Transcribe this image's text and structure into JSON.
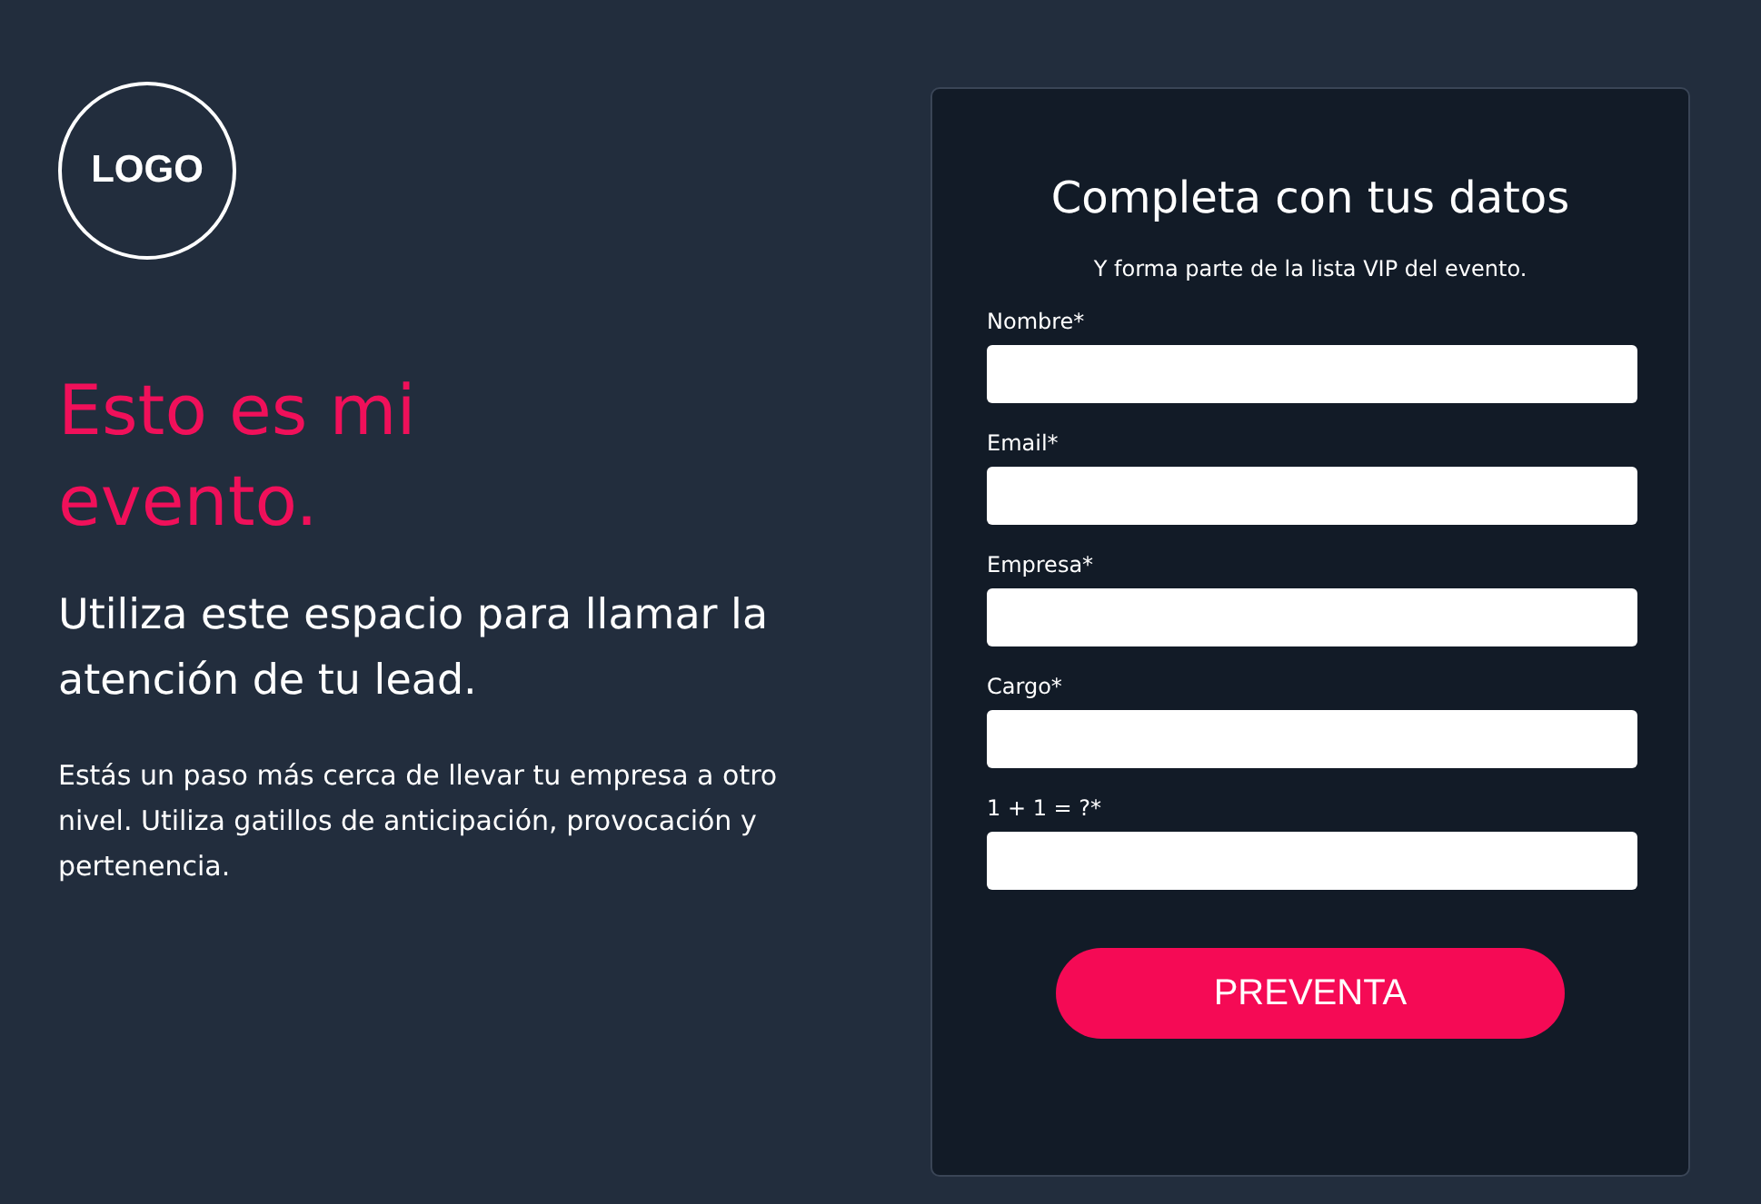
{
  "logo": {
    "text": "LOGO"
  },
  "hero": {
    "title": "Esto es mi evento.",
    "subtitle": "Utiliza este espacio para llamar la atención de tu lead.",
    "body": "Estás un paso más cerca de llevar tu empresa a otro nivel. Utiliza gatillos de anticipación, provocación y pertenencia."
  },
  "form": {
    "title": "Completa con tus datos",
    "subtitle": "Y forma parte de la lista VIP del evento.",
    "fields": [
      {
        "label": "Nombre*"
      },
      {
        "label": "Email*"
      },
      {
        "label": "Empresa*"
      },
      {
        "label": "Cargo*"
      },
      {
        "label": "1 + 1 = ?*"
      }
    ],
    "button": "PREVENTA"
  }
}
